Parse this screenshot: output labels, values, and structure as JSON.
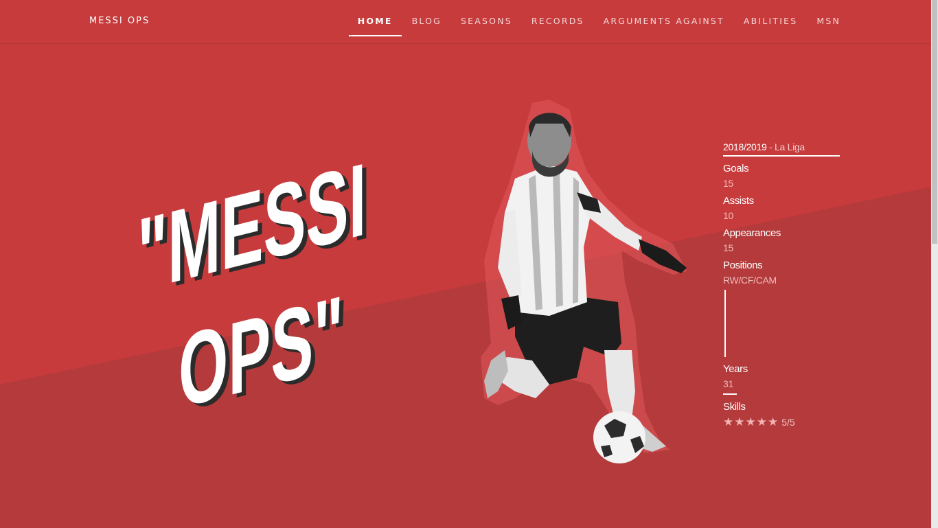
{
  "brand": "MESSI OPS",
  "nav": [
    {
      "label": "HOME",
      "active": true
    },
    {
      "label": "BLOG",
      "active": false
    },
    {
      "label": "SEASONS",
      "active": false
    },
    {
      "label": "RECORDS",
      "active": false
    },
    {
      "label": "ARGUMENTS AGAINST",
      "active": false
    },
    {
      "label": "ABILITIES",
      "active": false
    },
    {
      "label": "MSN",
      "active": false
    }
  ],
  "hero": {
    "line1": "\"MESSI",
    "line2": "OPS\""
  },
  "stats": {
    "season_year": "2018/2019",
    "season_league": " - La Liga",
    "goals_label": "Goals",
    "goals_value": "15",
    "assists_label": "Assists",
    "assists_value": "10",
    "appearances_label": "Appearances",
    "appearances_value": "15",
    "positions_label": "Positions",
    "positions_value": "RW/CF/CAM",
    "years_label": "Years",
    "years_value": "31",
    "skills_label": "Skills",
    "skills_text": "5/5",
    "skills_rating": 5
  },
  "colors": {
    "background": "#c73b3c",
    "lower_band": "#b23a3b",
    "text": "#ffffff"
  }
}
